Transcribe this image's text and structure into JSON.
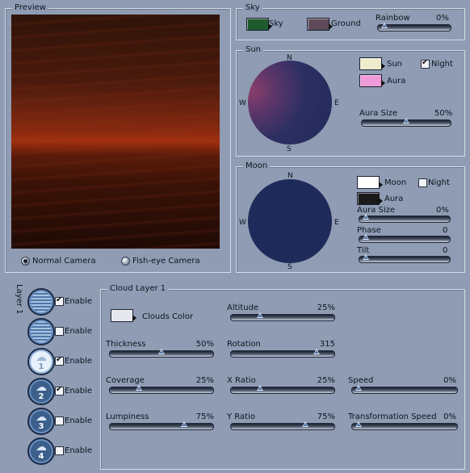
{
  "preview": {
    "title": "Preview",
    "camera_normal": "Normal Camera",
    "camera_fisheye": "Fish-eye Camera",
    "camera_selected": "Normal Camera"
  },
  "sky": {
    "title": "Sky",
    "sky_label": "Sky",
    "ground_label": "Ground",
    "rainbow_label": "Rainbow",
    "rainbow_value": "0%",
    "rainbow_level": 0,
    "sky_color": "#1e5a2e",
    "ground_color": "#5e4a58"
  },
  "sun": {
    "title": "Sun",
    "sun_label": "Sun",
    "aura_label": "Aura",
    "night_label": "Night",
    "night_checked": true,
    "aura_size_label": "Aura Size",
    "aura_size_value": "50%",
    "aura_size_level": 0.5,
    "sun_color": "#eeeccc",
    "aura_color": "#f09ad8",
    "compass": {
      "n": "N",
      "s": "S",
      "e": "E",
      "w": "W"
    }
  },
  "moon": {
    "title": "Moon",
    "moon_label": "Moon",
    "aura_label": "Aura",
    "night_label": "Night",
    "night_checked": false,
    "aura_size_label": "Aura Size",
    "aura_size_value": "0%",
    "aura_size_level": 0,
    "phase_label": "Phase",
    "phase_value": "0",
    "phase_level": 0,
    "tilt_label": "Tilt",
    "tilt_value": "0",
    "tilt_level": 0,
    "moon_color": "#ffffff",
    "aura_color": "#1a1a1a",
    "compass": {
      "n": "N",
      "s": "S",
      "e": "E",
      "w": "W"
    }
  },
  "layers": {
    "title": "Layer 1",
    "enable_label": "Enable",
    "items": [
      {
        "number": "",
        "enabled": true,
        "active": false
      },
      {
        "number": "",
        "enabled": false,
        "active": false
      },
      {
        "number": "1",
        "enabled": true,
        "active": true
      },
      {
        "number": "2",
        "enabled": true,
        "active": false
      },
      {
        "number": "3",
        "enabled": false,
        "active": false
      },
      {
        "number": "4",
        "enabled": false,
        "active": false
      }
    ]
  },
  "cloud_layer": {
    "title": "Cloud Layer 1",
    "clouds_color_label": "Clouds Color",
    "clouds_color": "#e6e8ee",
    "altitude": {
      "label": "Altitude",
      "value": "25%",
      "level": 0.25
    },
    "thickness": {
      "label": "Thickness",
      "value": "50%",
      "level": 0.5
    },
    "rotation": {
      "label": "Rotation",
      "value": "315",
      "level": 0.875
    },
    "coverage": {
      "label": "Coverage",
      "value": "25%",
      "level": 0.25
    },
    "x_ratio": {
      "label": "X Ratio",
      "value": "25%",
      "level": 0.25
    },
    "speed": {
      "label": "Speed",
      "value": "0%",
      "level": 0
    },
    "lumpiness": {
      "label": "Lumpiness",
      "value": "75%",
      "level": 0.75
    },
    "y_ratio": {
      "label": "Y Ratio",
      "value": "75%",
      "level": 0.75
    },
    "transformation_speed": {
      "label": "Transformation Speed",
      "value": "0%",
      "level": 0
    }
  }
}
